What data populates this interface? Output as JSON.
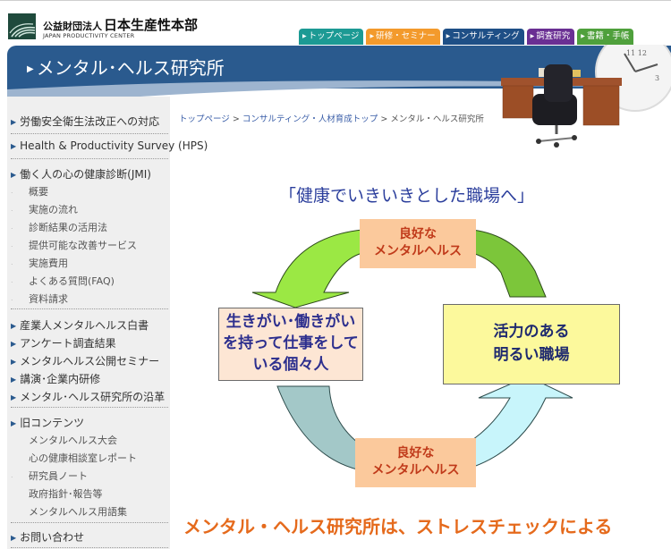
{
  "header": {
    "org_prefix": "公益財団法人",
    "org_name": "日本生産性本部",
    "org_english": "JAPAN PRODUCTIVITY CENTER"
  },
  "nav_tabs": [
    {
      "label": "トップページ",
      "color": "#1c9a94"
    },
    {
      "label": "研修・セミナー",
      "color": "#f39a2c"
    },
    {
      "label": "コンサルティング",
      "color": "#1e4f86"
    },
    {
      "label": "調査研究",
      "color": "#6a2f93"
    },
    {
      "label": "書籍・手帳",
      "color": "#4fa03c"
    }
  ],
  "banner": {
    "title": "メンタル･ヘルス研究所"
  },
  "sidebar": {
    "sections": [
      {
        "label": "労働安全衛生法改正への対応"
      },
      {
        "label": "Health & Productivity Survey (HPS)"
      },
      {
        "label": "働く人の心の健康診断(JMI)",
        "children": [
          "概要",
          "実施の流れ",
          "診断結果の活用法",
          "提供可能な改善サービス",
          "実施費用",
          "よくある質問(FAQ)",
          "資料請求"
        ]
      },
      {
        "label": "産業人メンタルヘルス白書"
      },
      {
        "label": "アンケート調査結果"
      },
      {
        "label": "メンタルヘルス公開セミナー"
      },
      {
        "label": "講演･企業内研修"
      },
      {
        "label": "メンタル･ヘルス研究所の沿革"
      },
      {
        "label": "旧コンテンツ",
        "children": [
          "メンタルヘルス大会",
          "心の健康相談室レポート",
          "研究員ノート",
          "政府指針･報告等",
          "メンタルヘルス用語集"
        ]
      },
      {
        "label": "お問い合わせ"
      }
    ]
  },
  "breadcrumb": {
    "items": [
      "トップページ",
      "コンサルティング・人材育成トップ"
    ],
    "separator": ">",
    "current": "メンタル・ヘルス研究所"
  },
  "main": {
    "slogan": "「健康でいきいきとした職場へ」",
    "diagram": {
      "top_label": [
        "良好な",
        "メンタルヘルス"
      ],
      "bottom_label": [
        "良好な",
        "メンタルヘルス"
      ],
      "left_box": [
        "生きがい･働きがい",
        "を持って仕事をして",
        "いる個々人"
      ],
      "right_box": [
        "活力のある",
        "明るい職場"
      ]
    },
    "bottom_heading": "メンタル・ヘルス研究所は、ストレスチェックによる"
  }
}
